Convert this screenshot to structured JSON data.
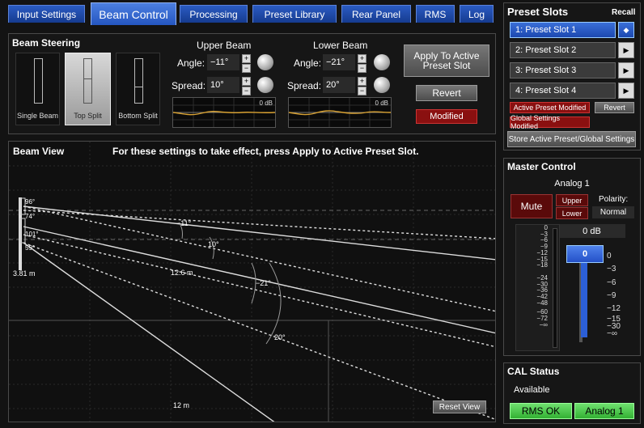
{
  "tabs": [
    {
      "label": "Input Settings"
    },
    {
      "label": "Beam Control"
    },
    {
      "label": "Processing"
    },
    {
      "label": "Preset Library"
    },
    {
      "label": "Rear Panel"
    },
    {
      "label": "RMS"
    },
    {
      "label": "Log"
    }
  ],
  "beam_steering": {
    "title": "Beam Steering",
    "modes": [
      {
        "label": "Single Beam"
      },
      {
        "label": "Top Split",
        "selected": true
      },
      {
        "label": "Bottom Split"
      }
    ]
  },
  "upper_beam": {
    "title": "Upper Beam",
    "angle_label": "Angle:",
    "angle": "−11°",
    "spread_label": "Spread:",
    "spread": "10°",
    "db": "0 dB"
  },
  "lower_beam": {
    "title": "Lower Beam",
    "angle_label": "Angle:",
    "angle": "−21°",
    "spread_label": "Spread:",
    "spread": "20°",
    "db": "0 dB"
  },
  "actions": {
    "apply": "Apply To Active Preset Slot",
    "revert": "Revert",
    "modified": "Modified"
  },
  "beam_view": {
    "title": "Beam View",
    "notice": "For these settings to take effect, press Apply to Active Preset Slot.",
    "labels": {
      "a96": "96°",
      "a74": "74°",
      "a101": "101°",
      "a59": "59°",
      "height": "3.81 m",
      "dist1": "12.6 m",
      "dist2": "12 m",
      "ang1": "−11°",
      "ang2": "10°",
      "ang3": "−21°",
      "ang4": "20°"
    },
    "reset": "Reset View"
  },
  "preset_slots": {
    "title": "Preset Slots",
    "recall": "Recall",
    "slots": [
      {
        "label": "1: Preset Slot 1",
        "active": true,
        "button": "◆"
      },
      {
        "label": "2: Preset Slot 2",
        "button": "▶"
      },
      {
        "label": "3: Preset Slot 3",
        "button": "▶"
      },
      {
        "label": "4: Preset Slot 4",
        "button": "▶"
      }
    ],
    "active_modified": "Active Preset Modified",
    "revert": "Revert",
    "global_modified": "Global Settings Modified",
    "store": "Store Active Preset/Global Settings"
  },
  "master_control": {
    "title": "Master Control",
    "input": "Analog 1",
    "mute": "Mute",
    "upper": "Upper",
    "lower": "Lower",
    "polarity_label": "Polarity:",
    "polarity": "Normal",
    "gain_readout": "0 dB",
    "fader_value": "0",
    "meter_scale": [
      "0",
      "−3",
      "−6",
      "−9",
      "−12",
      "−15",
      "−18",
      "−24",
      "−30",
      "−36",
      "−42",
      "−48",
      "−60",
      "−72",
      "−∞"
    ],
    "fader_scale": [
      "0",
      "−3",
      "−6",
      "−9",
      "−12",
      "−15",
      "−30",
      "−∞"
    ]
  },
  "cal_status": {
    "title": "CAL Status",
    "status": "Available",
    "rms": "RMS OK",
    "input": "Analog 1"
  },
  "colors": {
    "tab_blue": "#2a5bc2",
    "selected_blue": "#3a6fd8",
    "alert_red": "#8a1010",
    "ok_green": "#4cc94c",
    "fader_blue": "#2c5fd6",
    "eq_curve": "#d9a233"
  }
}
